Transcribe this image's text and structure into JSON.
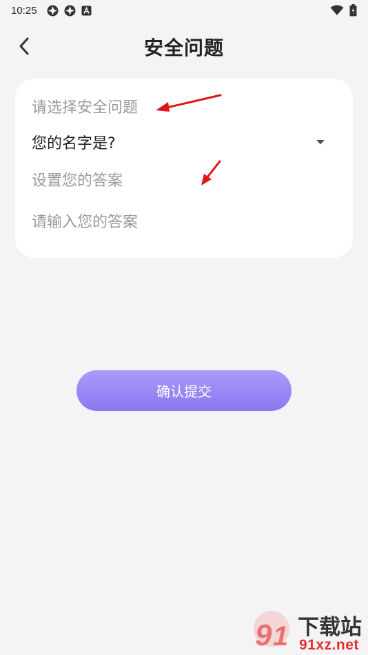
{
  "status_bar": {
    "time": "10:25",
    "left_icons": [
      "app-icon",
      "app-icon",
      "notification-a-icon"
    ],
    "right_icons": [
      "wifi-icon",
      "battery-icon"
    ]
  },
  "header": {
    "back_icon": "chevron-left-icon",
    "title": "安全问题"
  },
  "form": {
    "select_label": "请选择安全问题",
    "selected_question": "您的名字是?",
    "dropdown_icon": "caret-down-icon",
    "answer_label": "设置您的答案",
    "answer_placeholder": "请输入您的答案",
    "answer_value": ""
  },
  "submit": {
    "label": "确认提交"
  },
  "colors": {
    "background": "#f4f4f6",
    "card": "#ffffff",
    "accent_top": "#a99cf8",
    "accent_bottom": "#8a78f1",
    "annotation_arrow": "#e01515",
    "muted_text": "#9a9a9a"
  },
  "watermark": {
    "brand_text": "下载站",
    "domain_text": "91xz.net"
  }
}
